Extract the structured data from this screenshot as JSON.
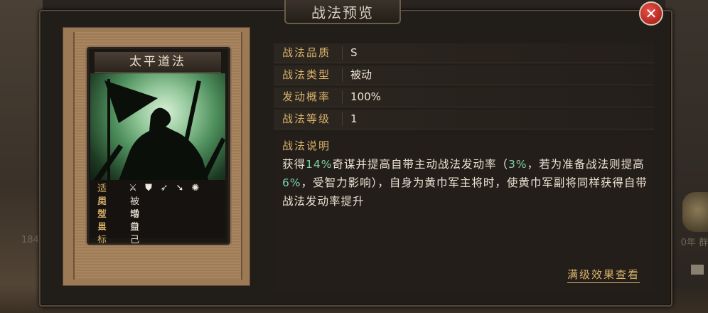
{
  "window": {
    "title": "战法预览",
    "close_label": "✕"
  },
  "background": {
    "left_text": "184",
    "right_text": "0年 群"
  },
  "card": {
    "name": "太平道法",
    "rows": [
      {
        "key": "适用",
        "icons": [
          "axe-icon",
          "shield-icon",
          "bow-icon",
          "spear-icon",
          "wheel-icon"
        ]
      },
      {
        "key": "类型",
        "value": "被动"
      },
      {
        "key": "效果",
        "value": "增益"
      },
      {
        "key": "目标",
        "value": "自己"
      }
    ]
  },
  "attributes": [
    {
      "label": "战法品质",
      "value": "S"
    },
    {
      "label": "战法类型",
      "value": "被动"
    },
    {
      "label": "发动概率",
      "value": "100%"
    },
    {
      "label": "战法等级",
      "value": "1"
    }
  ],
  "description": {
    "title": "战法说明",
    "segments": [
      {
        "text": "获得",
        "hl": false
      },
      {
        "text": "14%",
        "hl": true
      },
      {
        "text": "奇谋并提高自带主动战法发动率（",
        "hl": false
      },
      {
        "text": "3%",
        "hl": true
      },
      {
        "text": "，若为准备战法则提高",
        "hl": false
      },
      {
        "text": "6%",
        "hl": true
      },
      {
        "text": "，受智力影响），自身为黄巾军主将时，使黄巾军副将同样获得自带战法发动率提升",
        "hl": false
      }
    ]
  },
  "full_level_link": "满级效果查看",
  "colors": {
    "accent_gold": "#d9b36a",
    "highlight_green": "#7fd1a6",
    "close_red": "#d8352f"
  }
}
